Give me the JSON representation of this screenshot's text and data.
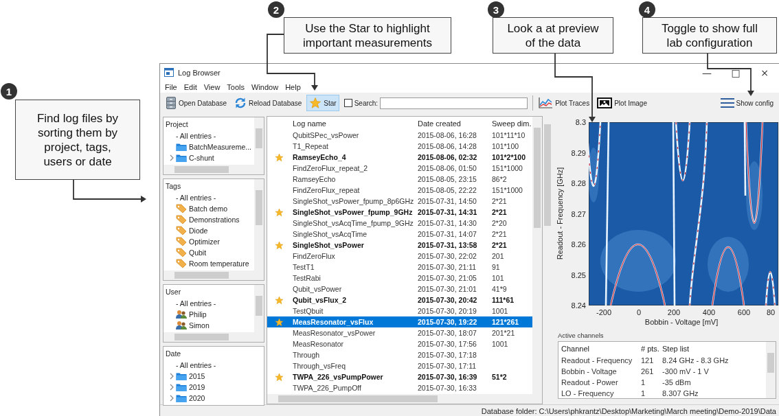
{
  "callouts": [
    {
      "number": "1",
      "text": "Find log files by\nsorting them by\nproject, tags,\nusers or date"
    },
    {
      "number": "2",
      "text": "Use the Star to highlight\nimportant measurements"
    },
    {
      "number": "3",
      "text": "Look a at preview\nof the data"
    },
    {
      "number": "4",
      "text": "Toggle to show full\nlab configuration"
    }
  ],
  "window": {
    "title": "Log Browser",
    "controls": [
      "—",
      "□",
      "×"
    ]
  },
  "menu": [
    "File",
    "Edit",
    "View",
    "Tools",
    "Window",
    "Help"
  ],
  "toolbar": {
    "buttons": [
      {
        "kind": "database",
        "label": "Open Database",
        "pressed": false
      },
      {
        "kind": "reload",
        "label": "Reload Database",
        "pressed": false
      },
      {
        "kind": "star",
        "label": "Star",
        "pressed": true
      }
    ],
    "search": {
      "label": "Search:",
      "checked": false
    },
    "views": [
      {
        "kind": "traces",
        "label": "Plot Traces"
      },
      {
        "kind": "image",
        "label": "Plot Image"
      }
    ],
    "config": {
      "label": "Show config"
    }
  },
  "filters": [
    {
      "title": "Project",
      "scrollable": true,
      "items": [
        {
          "kind": "all",
          "label": "- All entries -",
          "expandable": false
        },
        {
          "kind": "folder",
          "label": "BatchMeasureme...",
          "expandable": false
        },
        {
          "kind": "folder",
          "label": "C-shunt",
          "expandable": true
        }
      ]
    },
    {
      "title": "Tags",
      "scrollable": true,
      "items": [
        {
          "kind": "all",
          "label": "- All entries -",
          "expandable": false
        },
        {
          "kind": "tag",
          "label": "Batch demo",
          "expandable": false
        },
        {
          "kind": "tag",
          "label": "Demonstrations",
          "expandable": false
        },
        {
          "kind": "tag",
          "label": "Diode",
          "expandable": false
        },
        {
          "kind": "tag",
          "label": "Optimizer",
          "expandable": false
        },
        {
          "kind": "tag",
          "label": "Qubit",
          "expandable": false
        },
        {
          "kind": "tag",
          "label": "Room temperature",
          "expandable": false
        }
      ]
    },
    {
      "title": "User",
      "scrollable": true,
      "items": [
        {
          "kind": "all",
          "label": "- All entries -",
          "expandable": false
        },
        {
          "kind": "user",
          "label": "Philip",
          "expandable": false
        },
        {
          "kind": "user",
          "label": "Simon",
          "expandable": false
        }
      ]
    },
    {
      "title": "Date",
      "scrollable": false,
      "items": [
        {
          "kind": "all",
          "label": "- All entries -",
          "expandable": false
        },
        {
          "kind": "folder",
          "label": "2015",
          "expandable": true
        },
        {
          "kind": "folder",
          "label": "2019",
          "expandable": true
        },
        {
          "kind": "folder",
          "label": "2020",
          "expandable": true
        }
      ]
    }
  ],
  "table": {
    "columns": [
      "Log name",
      "Date created",
      "Sweep dim."
    ],
    "rows": [
      {
        "starred": false,
        "selected": false,
        "cells": [
          "QubitSPec_vsPower",
          "2015-08-06, 16:28",
          "101*11*10"
        ]
      },
      {
        "starred": false,
        "selected": false,
        "cells": [
          "T1_Repeat",
          "2015-08-06, 14:28",
          "101*100"
        ]
      },
      {
        "starred": true,
        "selected": false,
        "cells": [
          "RamseyEcho_4",
          "2015-08-06, 02:32",
          "101*2*100"
        ]
      },
      {
        "starred": false,
        "selected": false,
        "cells": [
          "FindZeroFlux_repeat_2",
          "2015-08-06, 01:50",
          "151*1000"
        ]
      },
      {
        "starred": false,
        "selected": false,
        "cells": [
          "RamseyEcho",
          "2015-08-05, 23:15",
          "86*2"
        ]
      },
      {
        "starred": false,
        "selected": false,
        "cells": [
          "FindZeroFlux_repeat",
          "2015-08-05, 22:22",
          "151*1000"
        ]
      },
      {
        "starred": false,
        "selected": false,
        "cells": [
          "SingleShot_vsPower_fpump_8p6GHz",
          "2015-07-31, 14:50",
          "2*21"
        ]
      },
      {
        "starred": true,
        "selected": false,
        "cells": [
          "SingleShot_vsPower_fpump_9GHz",
          "2015-07-31, 14:31",
          "2*21"
        ]
      },
      {
        "starred": false,
        "selected": false,
        "cells": [
          "SingleShot_vsAcqTime_fpump_9GHz",
          "2015-07-31, 14:30",
          "2*20"
        ]
      },
      {
        "starred": false,
        "selected": false,
        "cells": [
          "SingleShot_vsAcqTime",
          "2015-07-31, 14:07",
          "2*21"
        ]
      },
      {
        "starred": true,
        "selected": false,
        "cells": [
          "SingleShot_vsPower",
          "2015-07-31, 13:58",
          "2*21"
        ]
      },
      {
        "starred": false,
        "selected": false,
        "cells": [
          "FindZeroFlux",
          "2015-07-30, 22:02",
          "201"
        ]
      },
      {
        "starred": false,
        "selected": false,
        "cells": [
          "TestT1",
          "2015-07-30, 21:11",
          "91"
        ]
      },
      {
        "starred": false,
        "selected": false,
        "cells": [
          "TestRabi",
          "2015-07-30, 21:05",
          "101"
        ]
      },
      {
        "starred": false,
        "selected": false,
        "cells": [
          "Qubit_vsPower",
          "2015-07-30, 21:01",
          "41*9"
        ]
      },
      {
        "starred": true,
        "selected": false,
        "cells": [
          "Qubit_vsFlux_2",
          "2015-07-30, 20:42",
          "111*61"
        ]
      },
      {
        "starred": false,
        "selected": false,
        "cells": [
          "TestQbuit",
          "2015-07-30, 20:19",
          "1001"
        ]
      },
      {
        "starred": true,
        "selected": true,
        "cells": [
          "MeasResonator_vsFlux",
          "2015-07-30, 19:22",
          "121*261"
        ]
      },
      {
        "starred": false,
        "selected": false,
        "cells": [
          "MeasResonator_vsPower",
          "2015-07-30, 18:07",
          "201*21"
        ]
      },
      {
        "starred": false,
        "selected": false,
        "cells": [
          "MeasResonator",
          "2015-07-30, 17:56",
          "1001"
        ]
      },
      {
        "starred": false,
        "selected": false,
        "cells": [
          "Through",
          "2015-07-30, 17:18"
        ]
      },
      {
        "starred": false,
        "selected": false,
        "cells": [
          "Through_vsFreq",
          "2015-07-30, 17:11"
        ]
      },
      {
        "starred": true,
        "selected": false,
        "cells": [
          "TWPA_226_vsPumpPower",
          "2015-07-30, 16:39",
          "51*2"
        ]
      },
      {
        "starred": false,
        "selected": false,
        "cells": [
          "TWPA_226_PumpOff",
          "2015-07-30, 16:33"
        ]
      }
    ]
  },
  "plot": {
    "ylabel": "Readout - Frequency [GHz]",
    "xlabel": "Bobbin - Voltage [mV]",
    "yticks": [
      "8.3",
      "8.29",
      "8.28",
      "8.27",
      "8.26",
      "8.25",
      "8.24"
    ],
    "xticks": [
      "-200",
      "0",
      "200",
      "400",
      "600",
      "80"
    ]
  },
  "channels": {
    "title": "Active channels",
    "columns": [
      "Channel",
      "# pts.",
      "Step list"
    ],
    "rows": [
      [
        "Readout - Frequency",
        "121",
        "8.24 GHz - 8.3 GHz"
      ],
      [
        "Bobbin - Voltage",
        "261",
        "-300 mV - 1 V"
      ],
      [
        "Readout - Power",
        "1",
        "-35 dBm"
      ],
      [
        "LO - Frequency",
        "1",
        "8.307 GHz"
      ]
    ]
  },
  "status_bar": "Database folder: C:\\Users\\phkrantz\\Desktop\\Marketing\\March meeting\\Demo-2019\\Data"
}
